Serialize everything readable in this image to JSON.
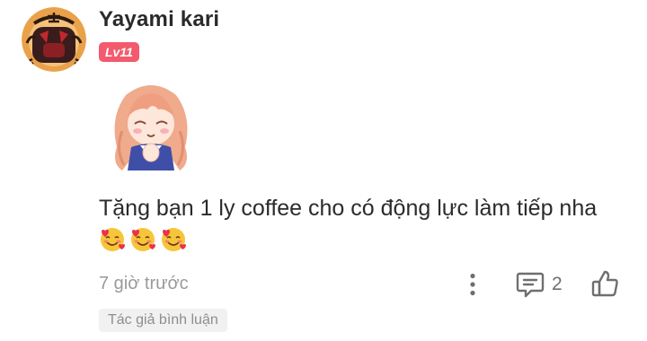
{
  "comment": {
    "username": "Yayami kari",
    "level": "Lv11",
    "text": "Tặng bạn 1 ly coffee cho có động lực làm tiếp nha",
    "emojis": [
      "smiling-face-with-hearts",
      "smiling-face-with-hearts",
      "smiling-face-with-hearts"
    ],
    "timestamp": "7 giờ trước",
    "reply_count": "2",
    "author_tag": "Tác giả bình luận"
  },
  "icons": {
    "avatar": "tiger-avatar",
    "sticker": "anime-girl-praying-sticker",
    "more": "vertical-dots-icon",
    "reply": "comment-bubble-icon",
    "like": "thumbs-up-icon"
  },
  "colors": {
    "level_badge": "#f35a6d",
    "muted_text": "#9a9a9a",
    "icon": "#6f6f6f",
    "tag_bg": "#f1f1f1"
  }
}
